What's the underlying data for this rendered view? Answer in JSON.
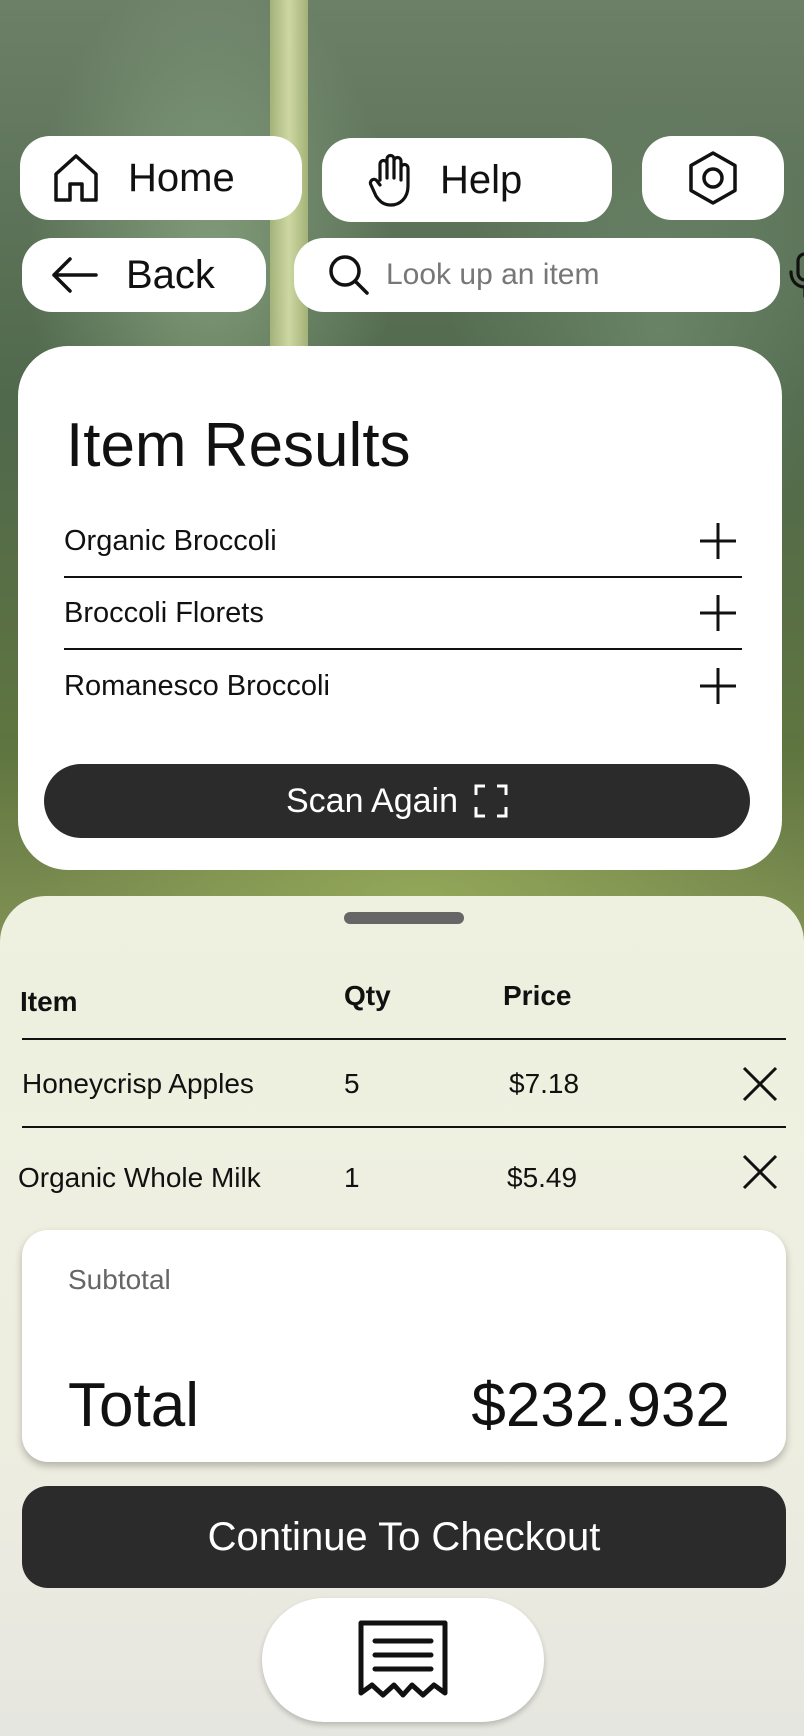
{
  "nav": {
    "home_label": "Home",
    "help_label": "Help",
    "back_label": "Back"
  },
  "search": {
    "placeholder": "Look up an item",
    "value": ""
  },
  "results": {
    "title": "Item Results",
    "items": [
      {
        "name": "Organic Broccoli"
      },
      {
        "name": "Broccoli Florets"
      },
      {
        "name": "Romanesco Broccoli"
      }
    ],
    "scan_label": "Scan Again"
  },
  "cart": {
    "headers": {
      "item": "Item",
      "qty": "Qty",
      "price": "Price"
    },
    "rows": [
      {
        "item": "Honeycrisp Apples",
        "qty": "5",
        "price": "$7.18"
      },
      {
        "item": "Organic Whole Milk",
        "qty": "1",
        "price": "$5.49"
      }
    ]
  },
  "summary": {
    "subtotal_label": "Subtotal",
    "total_label": "Total",
    "total_value": "$232.932"
  },
  "checkout": {
    "label": "Continue To Checkout"
  },
  "icons": {
    "home": "home-icon",
    "help": "hand-icon",
    "settings": "hexagon-settings-icon",
    "back": "arrow-left-icon",
    "search": "search-icon",
    "mic": "microphone-icon",
    "add": "plus-icon",
    "scan": "scan-frame-icon",
    "remove": "close-icon",
    "receipt": "receipt-icon"
  },
  "colors": {
    "dark_button": "#2b2b2b",
    "card": "#ffffff",
    "sheet": "#eef1df"
  }
}
